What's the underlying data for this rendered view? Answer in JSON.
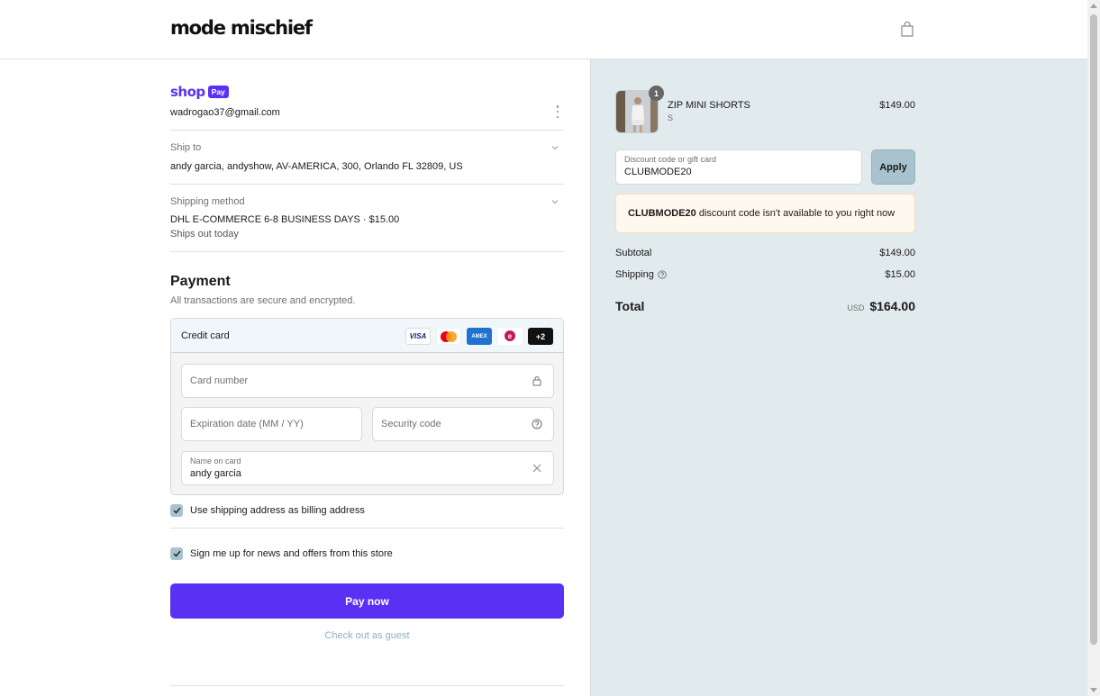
{
  "header": {
    "logo": "mode mischief",
    "cart_icon": "shopping-bag-icon"
  },
  "shop_pay": {
    "word": "shop",
    "pill": "Pay",
    "email": "wadrogao37@gmail.com"
  },
  "ship_to": {
    "label": "Ship to",
    "value": "andy garcia, andyshow, AV-AMERICA, 300, Orlando FL 32809, US"
  },
  "shipping_method": {
    "label": "Shipping method",
    "value": "DHL E-COMMERCE 6-8 BUSINESS DAYS · $15.00",
    "note": "Ships out today"
  },
  "payment": {
    "title": "Payment",
    "subtitle": "All transactions are secure and encrypted.",
    "method_label": "Credit card",
    "brands": [
      "VISA",
      "mastercard",
      "AMEX",
      "elo",
      "+2"
    ],
    "card_number_placeholder": "Card number",
    "expiry_placeholder": "Expiration date (MM / YY)",
    "security_placeholder": "Security code",
    "name_label": "Name on card",
    "name_value": "andy garcia"
  },
  "checkboxes": {
    "billing_same": "Use shipping address as billing address",
    "newsletter": "Sign me up for news and offers from this store"
  },
  "actions": {
    "pay_now": "Pay now",
    "guest": "Check out as guest"
  },
  "order": {
    "item_name": "ZIP MINI SHORTS",
    "item_variant": "S",
    "item_price": "$149.00",
    "item_qty": "1",
    "discount_label": "Discount code or gift card",
    "discount_value": "CLUBMODE20",
    "apply": "Apply",
    "notice_code": "CLUBMODE20",
    "notice_text": " discount code isn't available to you right now",
    "subtotal_label": "Subtotal",
    "subtotal_value": "$149.00",
    "shipping_label": "Shipping",
    "shipping_value": "$15.00",
    "total_label": "Total",
    "currency": "USD",
    "total_value": "$164.00"
  },
  "colors": {
    "accent": "#5a31f4",
    "sidebar_bg": "#e1eaed",
    "notice_bg": "#fff8ef"
  }
}
